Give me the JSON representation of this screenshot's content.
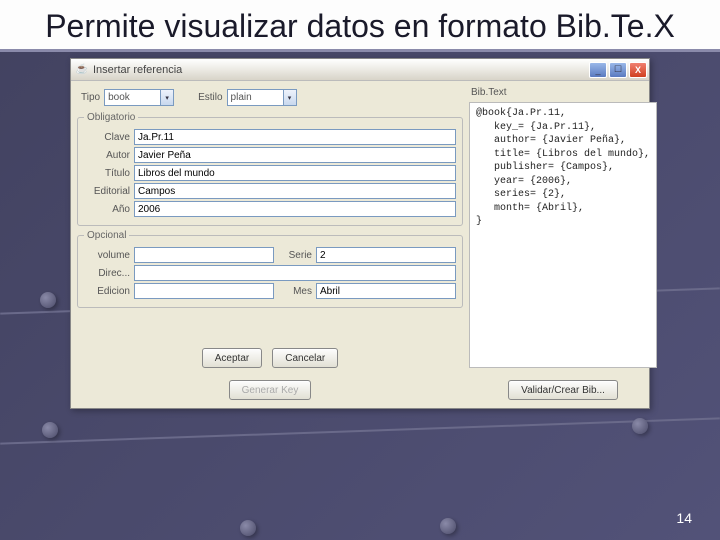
{
  "slide": {
    "title": "Permite visualizar datos en formato Bib.Te.X",
    "page_number": "14"
  },
  "window": {
    "title": "Insertar referencia",
    "min": "_",
    "max": "☐",
    "close": "X",
    "top": {
      "tipo_label": "Tipo",
      "tipo_value": "book",
      "estilo_label": "Estilo",
      "estilo_value": "plain"
    },
    "oblig": {
      "legend": "Obligatorio",
      "clave_label": "Clave",
      "clave_value": "Ja.Pr.11",
      "autor_label": "Autor",
      "autor_value": "Javier Peña",
      "titulo_label": "Título",
      "titulo_value": "Libros del mundo",
      "editorial_label": "Editorial",
      "editorial_value": "Campos",
      "ano_label": "Año",
      "ano_value": "2006"
    },
    "opc": {
      "legend": "Opcional",
      "volume_label": "volume",
      "volume_value": "",
      "serie_label": "Serie",
      "serie_value": "2",
      "direc_label": "Direc...",
      "direc_value": "",
      "edicion_label": "Edicion",
      "edicion_value": "",
      "mes_label": "Mes",
      "mes_value": "Abril"
    },
    "buttons": {
      "aceptar": "Aceptar",
      "cancelar": "Cancelar",
      "generar": "Generar Key",
      "validar": "Validar/Crear Bib..."
    },
    "bibtext_label": "Bib.Text",
    "bibtex_output": "@book{Ja.Pr.11,\n   key_= {Ja.Pr.11},\n   author= {Javier Peña},\n   title= {Libros del mundo},\n   publisher= {Campos},\n   year= {2006},\n   series= {2},\n   month= {Abril},\n}"
  }
}
